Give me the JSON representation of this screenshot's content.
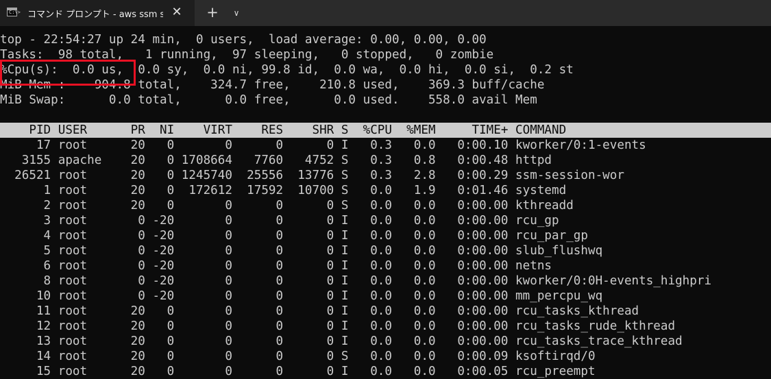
{
  "window": {
    "tab_title": "コマンド プロンプト - aws  ssm star",
    "tab_icon_prompt": "C:\\>",
    "close_glyph": "✕",
    "new_tab_glyph": "+",
    "dropdown_glyph": "∨"
  },
  "summary": [
    "top - 22:54:27 up 24 min,  0 users,  load average: 0.00, 0.00, 0.00",
    "Tasks:  98 total,   1 running,  97 sleeping,   0 stopped,   0 zombie",
    "%Cpu(s):  0.0 us,  0.0 sy,  0.0 ni, 99.8 id,  0.0 wa,  0.0 hi,  0.0 si,  0.2 st",
    "MiB Mem :    904.8 total,    324.7 free,    210.8 used,    369.3 buff/cache",
    "MiB Swap:      0.0 total,      0.0 free,      0.0 used.    558.0 avail Mem"
  ],
  "table_header": "    PID USER      PR  NI    VIRT    RES    SHR S  %CPU  %MEM     TIME+ COMMAND",
  "processes": [
    "     17 root      20   0       0      0      0 I   0.3   0.0   0:00.10 kworker/0:1-events",
    "   3155 apache    20   0 1708664   7760   4752 S   0.3   0.8   0:00.48 httpd",
    "  26521 root      20   0 1245740  25556  13776 S   0.3   2.8   0:00.29 ssm-session-wor",
    "      1 root      20   0  172612  17592  10700 S   0.0   1.9   0:01.46 systemd",
    "      2 root      20   0       0      0      0 S   0.0   0.0   0:00.00 kthreadd",
    "      3 root       0 -20       0      0      0 I   0.0   0.0   0:00.00 rcu_gp",
    "      4 root       0 -20       0      0      0 I   0.0   0.0   0:00.00 rcu_par_gp",
    "      5 root       0 -20       0      0      0 I   0.0   0.0   0:00.00 slub_flushwq",
    "      6 root       0 -20       0      0      0 I   0.0   0.0   0:00.00 netns",
    "      8 root       0 -20       0      0      0 I   0.0   0.0   0:00.00 kworker/0:0H-events_highpri",
    "     10 root       0 -20       0      0      0 I   0.0   0.0   0:00.00 mm_percpu_wq",
    "     11 root      20   0       0      0      0 I   0.0   0.0   0:00.00 rcu_tasks_kthread",
    "     12 root      20   0       0      0      0 I   0.0   0.0   0:00.00 rcu_tasks_rude_kthread",
    "     13 root      20   0       0      0      0 I   0.0   0.0   0:00.00 rcu_tasks_trace_kthread",
    "     14 root      20   0       0      0      0 S   0.0   0.0   0:00.09 ksoftirqd/0",
    "     15 root      20   0       0      0      0 I   0.0   0.0   0:00.05 rcu_preempt"
  ],
  "colors": {
    "terminal_bg": "#0c0c0c",
    "terminal_fg": "#cccccc",
    "highlight_border": "#e81123"
  }
}
